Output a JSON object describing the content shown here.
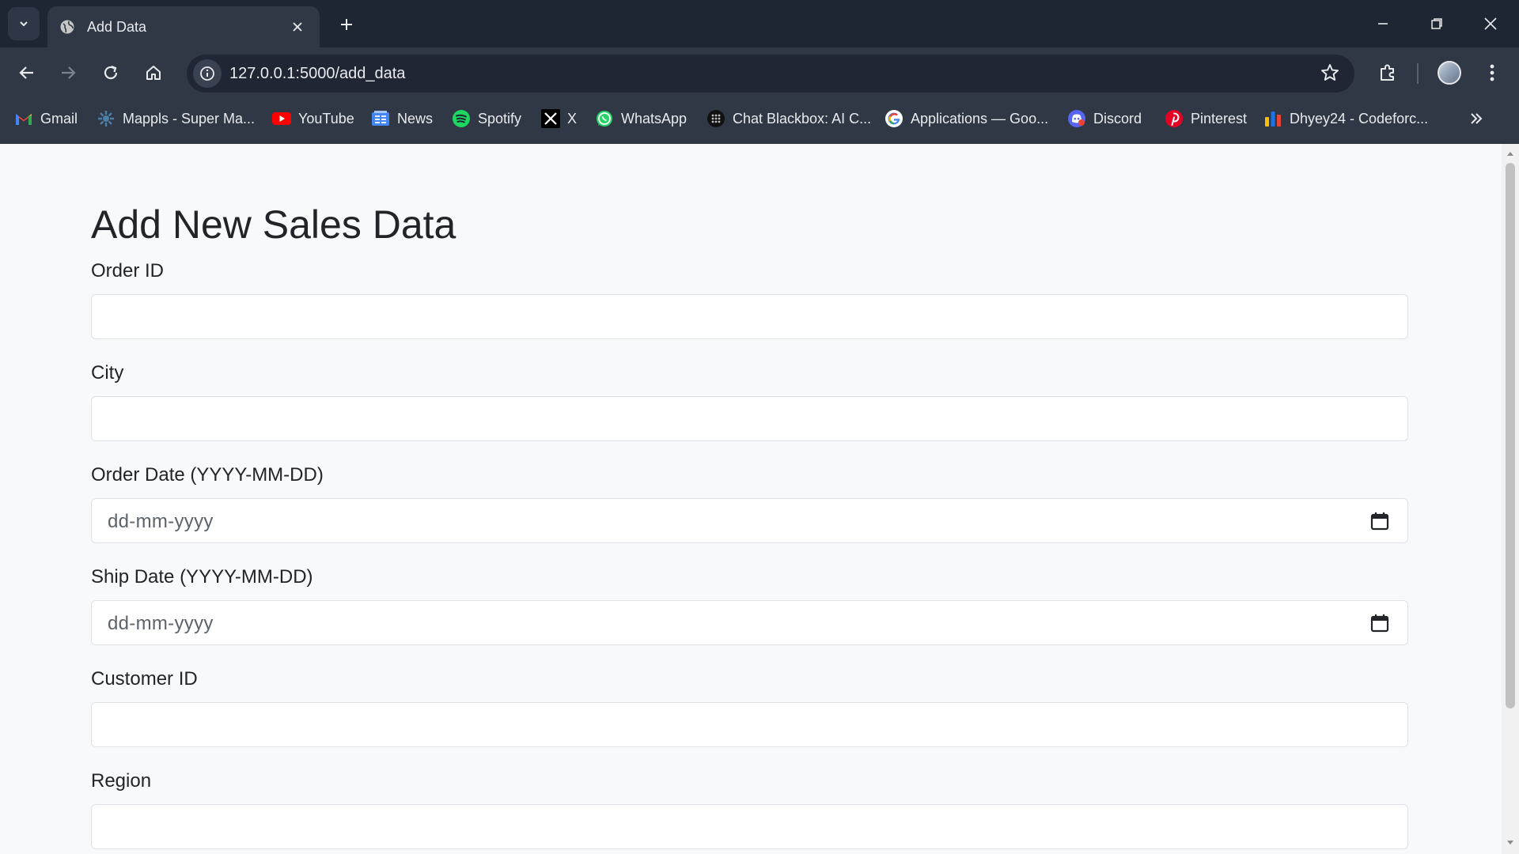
{
  "browser": {
    "tab_title": "Add Data",
    "url": "127.0.0.1:5000/add_data",
    "accent": "#1e2533"
  },
  "bookmarks": [
    {
      "label": "Gmail",
      "icon": "gmail-icon"
    },
    {
      "label": "Mappls - Super Ma...",
      "icon": "mappls-icon"
    },
    {
      "label": "YouTube",
      "icon": "youtube-icon"
    },
    {
      "label": "News",
      "icon": "google-news-icon"
    },
    {
      "label": "Spotify",
      "icon": "spotify-icon"
    },
    {
      "label": "X",
      "icon": "x-icon"
    },
    {
      "label": "WhatsApp",
      "icon": "whatsapp-icon"
    },
    {
      "label": "Chat Blackbox: AI C...",
      "icon": "blackbox-icon"
    },
    {
      "label": "Applications — Goo...",
      "icon": "google-icon"
    },
    {
      "label": "Discord",
      "icon": "discord-icon"
    },
    {
      "label": "Pinterest",
      "icon": "pinterest-icon"
    },
    {
      "label": "Dhyey24 - Codeforc...",
      "icon": "codeforces-icon"
    }
  ],
  "page": {
    "title": "Add New Sales Data",
    "fields": [
      {
        "label": "Order ID",
        "type": "text",
        "value": ""
      },
      {
        "label": "City",
        "type": "text",
        "value": ""
      },
      {
        "label": "Order Date (YYYY-MM-DD)",
        "type": "date",
        "placeholder": "dd-mm-yyyy"
      },
      {
        "label": "Ship Date (YYYY-MM-DD)",
        "type": "date",
        "placeholder": "dd-mm-yyyy"
      },
      {
        "label": "Customer ID",
        "type": "text",
        "value": ""
      },
      {
        "label": "Region",
        "type": "text",
        "value": ""
      }
    ]
  }
}
